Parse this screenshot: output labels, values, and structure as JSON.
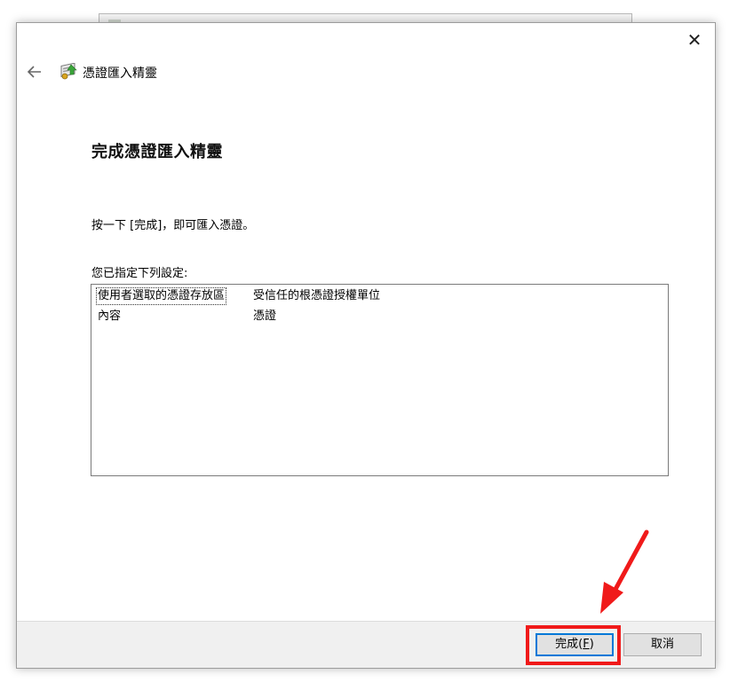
{
  "window": {
    "header_title": "憑證匯入精靈",
    "close_glyph": "✕"
  },
  "page": {
    "title": "完成憑證匯入精靈",
    "instruction": "按一下 [完成]，即可匯入憑證。",
    "settings_label": "您已指定下列設定:"
  },
  "settings": [
    {
      "key": "使用者選取的憑證存放區",
      "value": "受信任的根憑證授權單位"
    },
    {
      "key": "內容",
      "value": "憑證"
    }
  ],
  "footer": {
    "finish_text": "完成(",
    "finish_accel": "F",
    "finish_close": ")",
    "cancel_label": "取消"
  },
  "colors": {
    "accent": "#0078d7",
    "annotation": "#f01a1a",
    "footer_bg": "#f0f0f0"
  },
  "icons": {
    "back": "arrow-left-icon",
    "header": "certificate-icon",
    "close": "close-icon"
  }
}
